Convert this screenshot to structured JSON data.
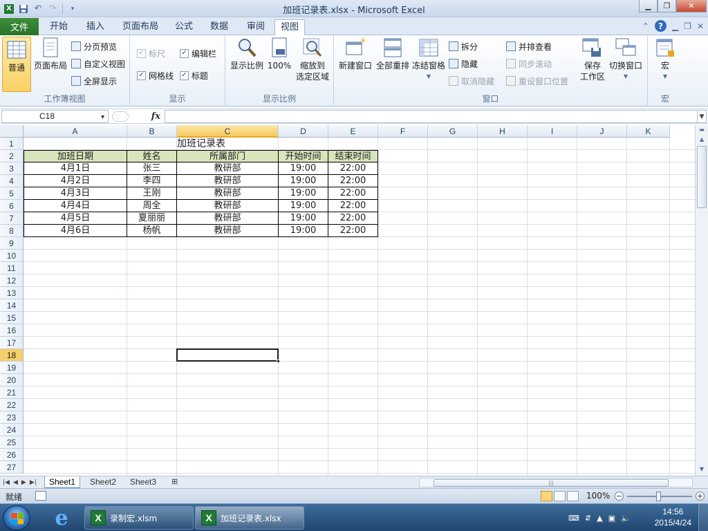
{
  "window": {
    "title": "加班记录表.xlsx - Microsoft Excel"
  },
  "tabs": {
    "file": "文件",
    "items": [
      "开始",
      "插入",
      "页面布局",
      "公式",
      "数据",
      "审阅",
      "视图"
    ],
    "active_index": 6
  },
  "ribbon": {
    "workbook_views": {
      "label": "工作簿视图",
      "normal": "普通",
      "page_layout": "页面布局",
      "page_break": "分页预览",
      "custom_views": "自定义视图",
      "full_screen": "全屏显示"
    },
    "show": {
      "label": "显示",
      "ruler": "标尺",
      "formula_bar": "编辑栏",
      "gridlines": "网格线",
      "headings": "标题",
      "ruler_checked": true,
      "formula_bar_checked": true,
      "gridlines_checked": true,
      "headings_checked": true
    },
    "zoom": {
      "label": "显示比例",
      "zoom": "显示比例",
      "hundred": "100%",
      "zoom_selection_line1": "缩放到",
      "zoom_selection_line2": "选定区域"
    },
    "window": {
      "label": "窗口",
      "new_window": "新建窗口",
      "arrange_all": "全部重排",
      "freeze_panes": "冻结窗格",
      "split": "拆分",
      "hide": "隐藏",
      "unhide": "取消隐藏",
      "side_by_side": "并排查看",
      "sync_scroll": "同步滚动",
      "reset_position": "重设窗口位置",
      "save_workspace_line1": "保存",
      "save_workspace_line2": "工作区",
      "switch_windows": "切换窗口"
    },
    "macros": {
      "label": "宏",
      "macros": "宏"
    }
  },
  "formula_bar": {
    "name_box": "C18",
    "fx": "fx",
    "formula": ""
  },
  "sheet": {
    "columns": [
      "A",
      "B",
      "C",
      "D",
      "E",
      "F",
      "G",
      "H",
      "I",
      "J",
      "K"
    ],
    "rows": [
      "1",
      "2",
      "3",
      "4",
      "5",
      "6",
      "7",
      "8",
      "9",
      "10",
      "11",
      "12",
      "13",
      "14",
      "15",
      "16",
      "17",
      "18",
      "19",
      "20",
      "21",
      "22",
      "23",
      "24",
      "25",
      "26",
      "27"
    ],
    "active_column": "C",
    "active_row": "18",
    "table_title": "加班记录表",
    "headers": [
      "加班日期",
      "姓名",
      "所属部门",
      "开始时间",
      "结束时间"
    ],
    "records": [
      [
        "4月1日",
        "张三",
        "教研部",
        "19:00",
        "22:00"
      ],
      [
        "4月2日",
        "李四",
        "教研部",
        "19:00",
        "22:00"
      ],
      [
        "4月3日",
        "王刚",
        "教研部",
        "19:00",
        "22:00"
      ],
      [
        "4月4日",
        "周全",
        "教研部",
        "19:00",
        "22:00"
      ],
      [
        "4月5日",
        "夏丽丽",
        "教研部",
        "19:00",
        "22:00"
      ],
      [
        "4月6日",
        "杨帆",
        "教研部",
        "19:00",
        "22:00"
      ]
    ],
    "header_fill": "#d8e4bc"
  },
  "sheet_tabs": [
    "Sheet1",
    "Sheet2",
    "Sheet3"
  ],
  "status": {
    "ready": "就绪",
    "zoom": "100%"
  },
  "taskbar": {
    "items": [
      "录制宏.xlsm",
      "加班记录表.xlsx"
    ],
    "active_index": 1,
    "time": "14:56",
    "date": "2015/4/24"
  },
  "colors": {
    "accent_green": "#2a7327",
    "selection_gold": "#f7cf6a",
    "ribbon_blue": "#dfe9f5"
  }
}
